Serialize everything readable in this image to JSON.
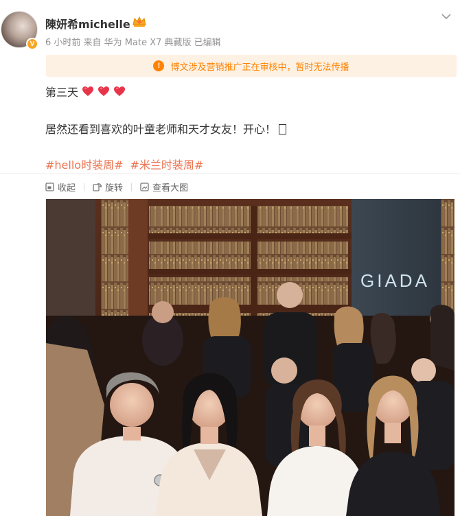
{
  "user": {
    "name": "陳妍希michelle",
    "verified_badge": "V",
    "meta": "6 小时前  来自 华为 Mate X7 典藏版 已编辑"
  },
  "notice": {
    "icon": "!",
    "text": "博文涉及营销推广正在审核中，暂时无法传播"
  },
  "post": {
    "line1": "第三天",
    "line2": "居然还看到喜欢的叶童老师和天才女友！开心！",
    "tags": [
      "#hello时装周#",
      "#米兰时装周#"
    ]
  },
  "toolbar": {
    "collect": "收起",
    "rotate": "旋转",
    "view_large": "查看大图"
  },
  "photo": {
    "sign_text": "GIADA"
  },
  "colors": {
    "link_orange": "#eb7350",
    "notice_orange": "#ff8200",
    "notice_bg": "#fdf1e3",
    "meta_gray": "#939393"
  }
}
